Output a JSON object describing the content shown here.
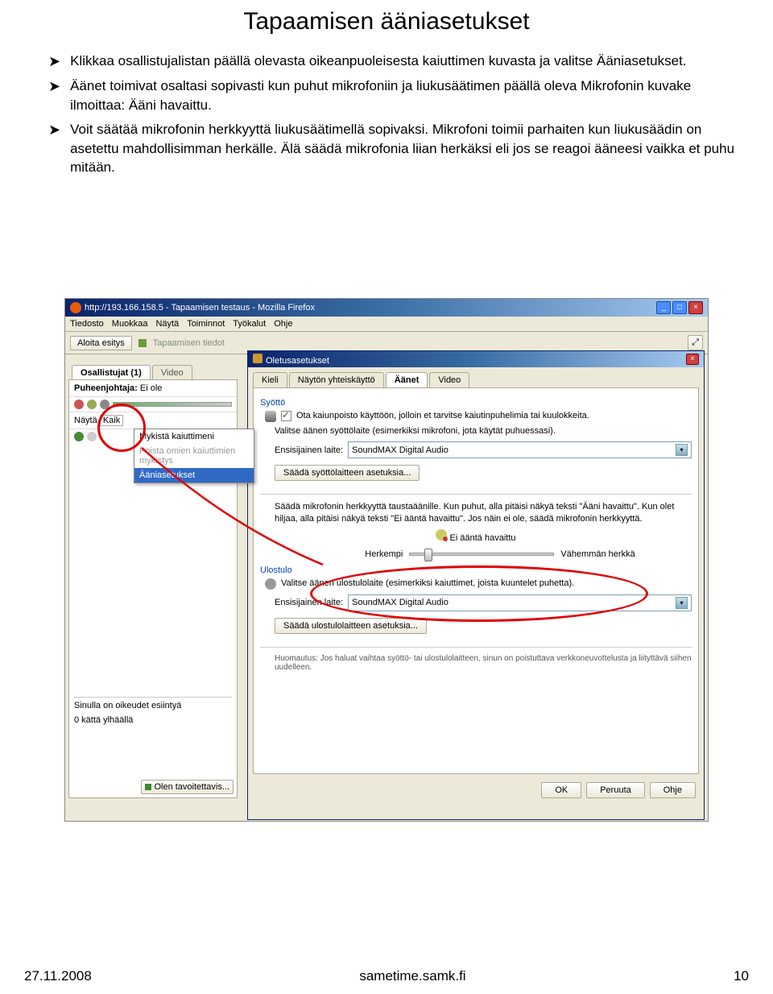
{
  "page": {
    "title": "Tapaamisen ääniasetukset"
  },
  "bullets": [
    "Klikkaa osallistujalistan päällä olevasta oikeanpuoleisesta kaiuttimen kuvasta ja valitse Ääniasetukset.",
    "Äänet toimivat osaltasi sopivasti kun puhut mikrofoniin ja liukusäätimen päällä oleva Mikrofonin kuvake ilmoittaa: Ääni havaittu.",
    "Voit säätää mikrofonin herkkyyttä liukusäätimellä sopivaksi. Mikrofoni toimii parhaiten kun liukusäädin on asetettu mahdollisimman herkälle. Älä säädä mikrofonia liian herkäksi eli jos se reagoi ääneesi vaikka et puhu mitään."
  ],
  "firefox": {
    "title": "http://193.166.158.5 - Tapaamisen testaus - Mozilla Firefox",
    "menu": [
      "Tiedosto",
      "Muokkaa",
      "Näytä",
      "Toiminnot",
      "Työkalut",
      "Ohje"
    ],
    "toolbar": {
      "start": "Aloita esitys",
      "info": "Tapaamisen tiedot"
    },
    "tabs": [
      "Osallistujat (1)",
      "Video"
    ],
    "chair_label": "Puheenjohtaja:",
    "chair_value": "Ei ole",
    "show_label": "Näytä",
    "show_value": "Kaik",
    "context_menu": {
      "mute_mine": "Mykistä kaiuttimeni",
      "unmute_all": "Poista omien kaiuttimien mykistys",
      "audio_settings": "Ääniasetukset"
    },
    "rights": "Sinulla on oikeudet esiintyä",
    "hands": "0 kättä ylhäällä",
    "status": "Olen tavoitettavis..."
  },
  "dialog": {
    "title": "Oletusasetukset",
    "tabs": [
      "Kieli",
      "Näytön yhteiskäyttö",
      "Äänet",
      "Video"
    ],
    "input_section": "Syöttö",
    "echo_cancel": "Ota kaiunpoisto käyttöön, jolloin et tarvitse kaiutinpuhelimia tai kuulokkeita.",
    "select_input": "Valitse äänen syöttölaite (esimerkiksi mikrofoni, jota käytät puhuessasi).",
    "primary_device_label": "Ensisijainen laite:",
    "primary_device_value": "SoundMAX Digital Audio",
    "adjust_input": "Säädä syöttölaitteen asetuksia...",
    "sensitivity_desc": "Säädä mikrofonin herkkyyttä taustaäänille. Kun puhut, alla pitäisi näkyä teksti \"Ääni havaittu\". Kun olet hiljaa, alla pitäisi näkyä teksti \"Ei ääntä havaittu\". Jos näin ei ole, säädä mikrofonin herkkyyttä.",
    "no_sound": "Ei ääntä havaittu",
    "more_sensitive": "Herkempi",
    "less_sensitive": "Vähemmän herkkä",
    "output_section": "Ulostulo",
    "select_output": "Valitse äänen ulostulolaite (esimerkiksi kaiuttimet, joista kuuntelet puhetta).",
    "adjust_output": "Säädä ulostulolaitteen asetuksia...",
    "note": "Huomautus: Jos haluat vaihtaa syöttö- tai ulostulolaitteen, sinun on poistuttava verkkoneuvottelusta ja liityttävä siihen uudelleen.",
    "btn_ok": "OK",
    "btn_cancel": "Peruuta",
    "btn_help": "Ohje"
  },
  "footer": {
    "date": "27.11.2008",
    "center": "sametime.samk.fi",
    "page": "10"
  }
}
